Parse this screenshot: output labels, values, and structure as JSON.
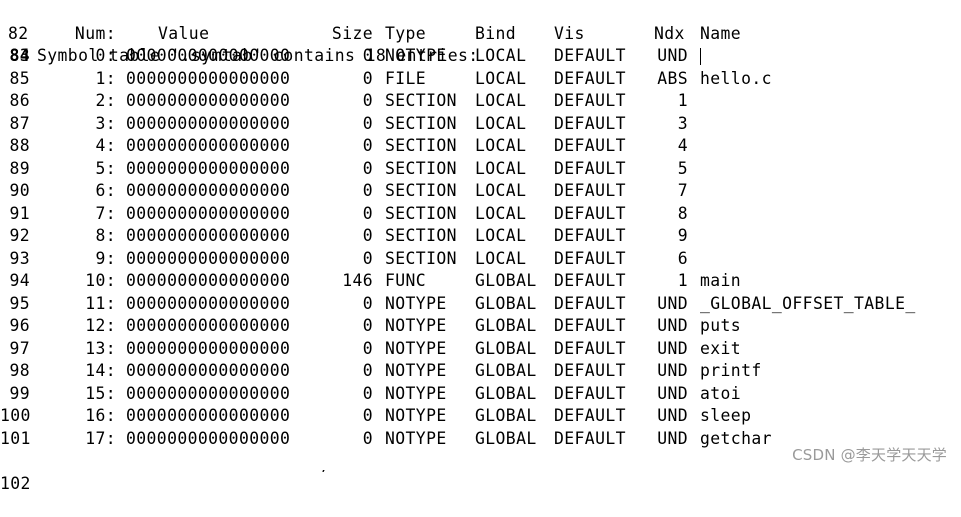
{
  "heading": "Symbol table '.symtab' contains 18 entries:",
  "first_line_number": "82",
  "header": {
    "line": "83",
    "num": "Num:",
    "value": "Value",
    "size": "Size",
    "type": "Type",
    "bind": "Bind",
    "vis": "Vis",
    "ndx": "Ndx",
    "name": "Name"
  },
  "rows": [
    {
      "line": "84",
      "num": "0:",
      "value": "0000000000000000",
      "size": "0",
      "type": "NOTYPE",
      "bind": "LOCAL",
      "vis": "DEFAULT",
      "ndx": "UND",
      "name": ""
    },
    {
      "line": "85",
      "num": "1:",
      "value": "0000000000000000",
      "size": "0",
      "type": "FILE",
      "bind": "LOCAL",
      "vis": "DEFAULT",
      "ndx": "ABS",
      "name": "hello.c"
    },
    {
      "line": "86",
      "num": "2:",
      "value": "0000000000000000",
      "size": "0",
      "type": "SECTION",
      "bind": "LOCAL",
      "vis": "DEFAULT",
      "ndx": "1",
      "name": ""
    },
    {
      "line": "87",
      "num": "3:",
      "value": "0000000000000000",
      "size": "0",
      "type": "SECTION",
      "bind": "LOCAL",
      "vis": "DEFAULT",
      "ndx": "3",
      "name": ""
    },
    {
      "line": "88",
      "num": "4:",
      "value": "0000000000000000",
      "size": "0",
      "type": "SECTION",
      "bind": "LOCAL",
      "vis": "DEFAULT",
      "ndx": "4",
      "name": ""
    },
    {
      "line": "89",
      "num": "5:",
      "value": "0000000000000000",
      "size": "0",
      "type": "SECTION",
      "bind": "LOCAL",
      "vis": "DEFAULT",
      "ndx": "5",
      "name": ""
    },
    {
      "line": "90",
      "num": "6:",
      "value": "0000000000000000",
      "size": "0",
      "type": "SECTION",
      "bind": "LOCAL",
      "vis": "DEFAULT",
      "ndx": "7",
      "name": ""
    },
    {
      "line": "91",
      "num": "7:",
      "value": "0000000000000000",
      "size": "0",
      "type": "SECTION",
      "bind": "LOCAL",
      "vis": "DEFAULT",
      "ndx": "8",
      "name": ""
    },
    {
      "line": "92",
      "num": "8:",
      "value": "0000000000000000",
      "size": "0",
      "type": "SECTION",
      "bind": "LOCAL",
      "vis": "DEFAULT",
      "ndx": "9",
      "name": ""
    },
    {
      "line": "93",
      "num": "9:",
      "value": "0000000000000000",
      "size": "0",
      "type": "SECTION",
      "bind": "LOCAL",
      "vis": "DEFAULT",
      "ndx": "6",
      "name": ""
    },
    {
      "line": "94",
      "num": "10:",
      "value": "0000000000000000",
      "size": "146",
      "type": "FUNC",
      "bind": "GLOBAL",
      "vis": "DEFAULT",
      "ndx": "1",
      "name": "main"
    },
    {
      "line": "95",
      "num": "11:",
      "value": "0000000000000000",
      "size": "0",
      "type": "NOTYPE",
      "bind": "GLOBAL",
      "vis": "DEFAULT",
      "ndx": "UND",
      "name": "_GLOBAL_OFFSET_TABLE_"
    },
    {
      "line": "96",
      "num": "12:",
      "value": "0000000000000000",
      "size": "0",
      "type": "NOTYPE",
      "bind": "GLOBAL",
      "vis": "DEFAULT",
      "ndx": "UND",
      "name": "puts"
    },
    {
      "line": "97",
      "num": "13:",
      "value": "0000000000000000",
      "size": "0",
      "type": "NOTYPE",
      "bind": "GLOBAL",
      "vis": "DEFAULT",
      "ndx": "UND",
      "name": "exit"
    },
    {
      "line": "98",
      "num": "14:",
      "value": "0000000000000000",
      "size": "0",
      "type": "NOTYPE",
      "bind": "GLOBAL",
      "vis": "DEFAULT",
      "ndx": "UND",
      "name": "printf"
    },
    {
      "line": "99",
      "num": "15:",
      "value": "0000000000000000",
      "size": "0",
      "type": "NOTYPE",
      "bind": "GLOBAL",
      "vis": "DEFAULT",
      "ndx": "UND",
      "name": "atoi"
    },
    {
      "line": "100",
      "num": "16:",
      "value": "0000000000000000",
      "size": "0",
      "type": "NOTYPE",
      "bind": "GLOBAL",
      "vis": "DEFAULT",
      "ndx": "UND",
      "name": "sleep"
    },
    {
      "line": "101",
      "num": "17:",
      "value": "0000000000000000",
      "size": "0",
      "type": "NOTYPE",
      "bind": "GLOBAL",
      "vis": "DEFAULT",
      "ndx": "UND",
      "name": "getchar"
    }
  ],
  "last_line_number": "102",
  "current_line": "84",
  "watermark": "CSDN @李天学天天学"
}
